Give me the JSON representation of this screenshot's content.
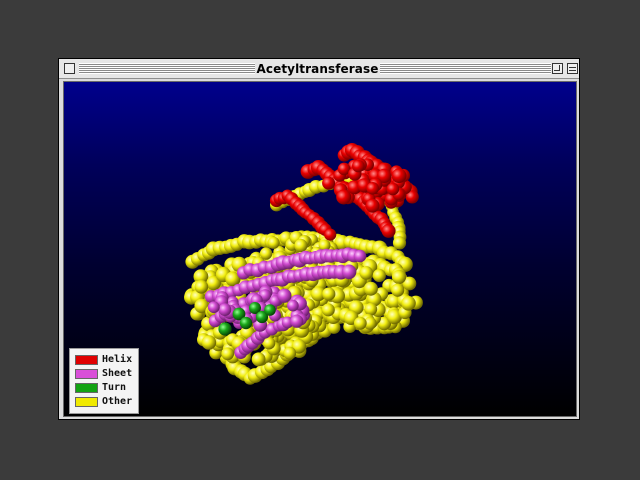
{
  "window": {
    "title": "Acetyltransferase"
  },
  "legend": {
    "items": [
      {
        "label": "Helix",
        "color": "#e00000"
      },
      {
        "label": "Sheet",
        "color": "#d94fd8"
      },
      {
        "label": "Turn",
        "color": "#13a313"
      },
      {
        "label": "Other",
        "color": "#f0ea00"
      }
    ]
  }
}
